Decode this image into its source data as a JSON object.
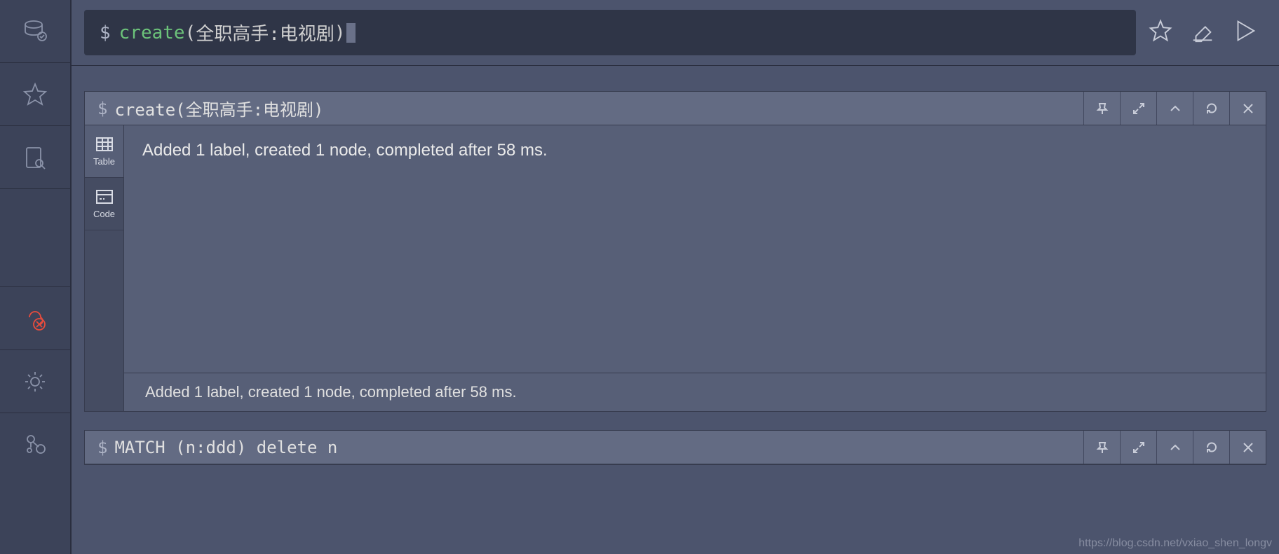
{
  "editor": {
    "prompt": "$",
    "code": {
      "keyword": "create",
      "paren_open": "(",
      "args": "全职高手:电视剧",
      "paren_close": ")"
    }
  },
  "sidebar": {
    "icons": [
      "database",
      "star",
      "document-search",
      "cloud-error",
      "settings",
      "relations"
    ]
  },
  "editor_actions": {
    "favorite": "favorite",
    "clear": "clear",
    "run": "run"
  },
  "panels": [
    {
      "query_prompt": "$",
      "query_text": "create(全职高手:电视剧)",
      "views": [
        {
          "id": "table",
          "label": "Table"
        },
        {
          "id": "code",
          "label": "Code"
        }
      ],
      "result_message": "Added 1 label, created 1 node, completed after 58 ms.",
      "footer_message": "Added 1 label, created 1 node, completed after 58 ms."
    },
    {
      "query_prompt": "$",
      "query_text": "MATCH (n:ddd) delete n",
      "views": [],
      "result_message": "",
      "footer_message": ""
    }
  ],
  "watermark": "https://blog.csdn.net/vxiao_shen_longv"
}
